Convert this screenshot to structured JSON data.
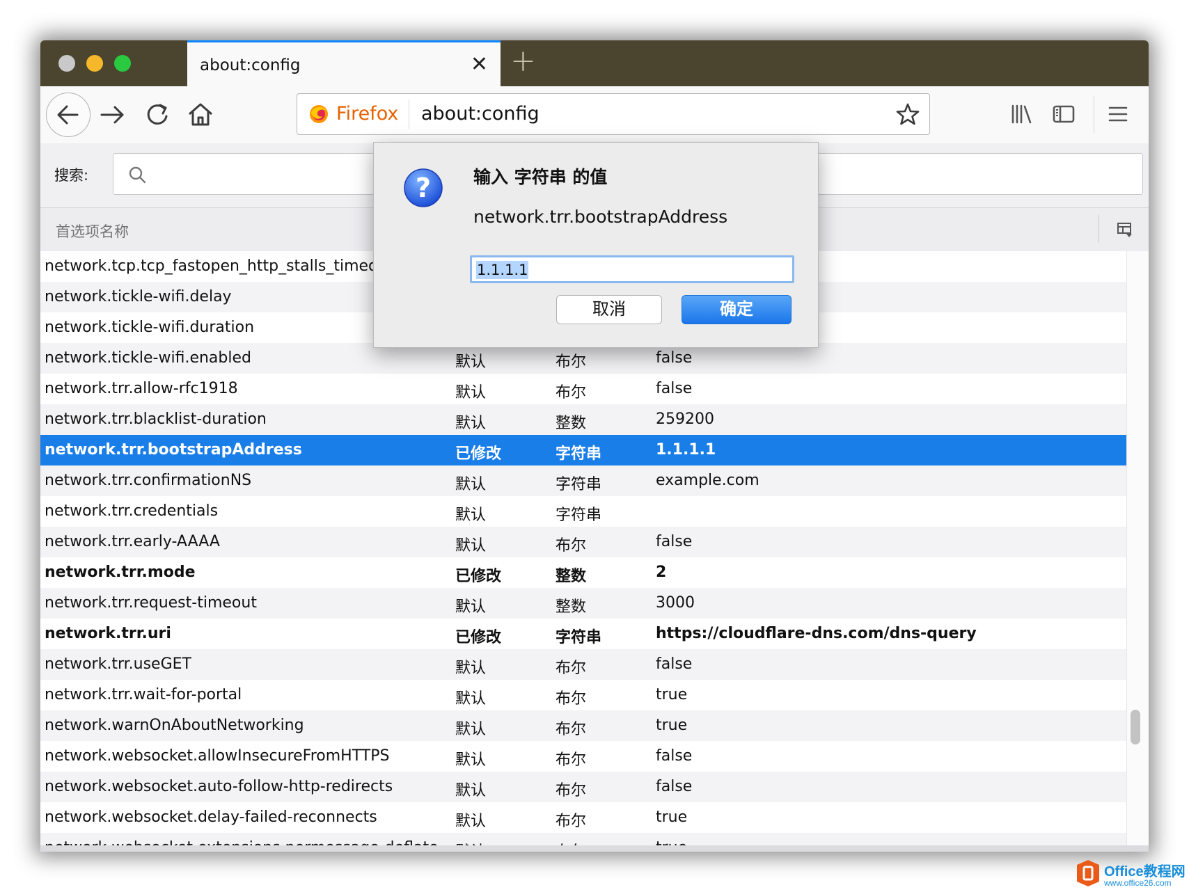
{
  "colors": {
    "titlebar": "#4b4530",
    "selection": "#1a7ee8",
    "firefox_orange": "#e66000",
    "tab_accent": "#0a84ff"
  },
  "tab": {
    "title": "about:config",
    "close_icon": "close-icon",
    "new_tab_icon": "plus-icon"
  },
  "urlbar": {
    "brand": "Firefox",
    "url": "about:config"
  },
  "search": {
    "label": "搜索:",
    "value": ""
  },
  "columns": {
    "name": "首选项名称"
  },
  "rows": [
    {
      "name": "network.tcp.tcp_fastopen_http_stalls_timeout",
      "status": "",
      "type": "",
      "value": ""
    },
    {
      "name": "network.tickle-wifi.delay",
      "status": "",
      "type": "",
      "value": ""
    },
    {
      "name": "network.tickle-wifi.duration",
      "status": "",
      "type": "",
      "value": ""
    },
    {
      "name": "network.tickle-wifi.enabled",
      "status": "默认",
      "type": "布尔",
      "value": "false"
    },
    {
      "name": "network.trr.allow-rfc1918",
      "status": "默认",
      "type": "布尔",
      "value": "false"
    },
    {
      "name": "network.trr.blacklist-duration",
      "status": "默认",
      "type": "整数",
      "value": "259200"
    },
    {
      "name": "network.trr.bootstrapAddress",
      "status": "已修改",
      "type": "字符串",
      "value": "1.1.1.1"
    },
    {
      "name": "network.trr.confirmationNS",
      "status": "默认",
      "type": "字符串",
      "value": "example.com"
    },
    {
      "name": "network.trr.credentials",
      "status": "默认",
      "type": "字符串",
      "value": ""
    },
    {
      "name": "network.trr.early-AAAA",
      "status": "默认",
      "type": "布尔",
      "value": "false"
    },
    {
      "name": "network.trr.mode",
      "status": "已修改",
      "type": "整数",
      "value": "2"
    },
    {
      "name": "network.trr.request-timeout",
      "status": "默认",
      "type": "整数",
      "value": "3000"
    },
    {
      "name": "network.trr.uri",
      "status": "已修改",
      "type": "字符串",
      "value": "https://cloudflare-dns.com/dns-query"
    },
    {
      "name": "network.trr.useGET",
      "status": "默认",
      "type": "布尔",
      "value": "false"
    },
    {
      "name": "network.trr.wait-for-portal",
      "status": "默认",
      "type": "布尔",
      "value": "true"
    },
    {
      "name": "network.warnOnAboutNetworking",
      "status": "默认",
      "type": "布尔",
      "value": "true"
    },
    {
      "name": "network.websocket.allowInsecureFromHTTPS",
      "status": "默认",
      "type": "布尔",
      "value": "false"
    },
    {
      "name": "network.websocket.auto-follow-http-redirects",
      "status": "默认",
      "type": "布尔",
      "value": "false"
    },
    {
      "name": "network.websocket.delay-failed-reconnects",
      "status": "默认",
      "type": "布尔",
      "value": "true"
    },
    {
      "name": "network.websocket.extensions.permessage-deflate",
      "status": "默认",
      "type": "布尔",
      "value": "true"
    }
  ],
  "dialog": {
    "title": "输入 字符串 的值",
    "pref_name": "network.trr.bootstrapAddress",
    "input_value": "1.1.1.1",
    "cancel_label": "取消",
    "ok_label": "确定"
  },
  "watermark": {
    "line1": "Office教程网",
    "line2": "www.office26.com"
  }
}
